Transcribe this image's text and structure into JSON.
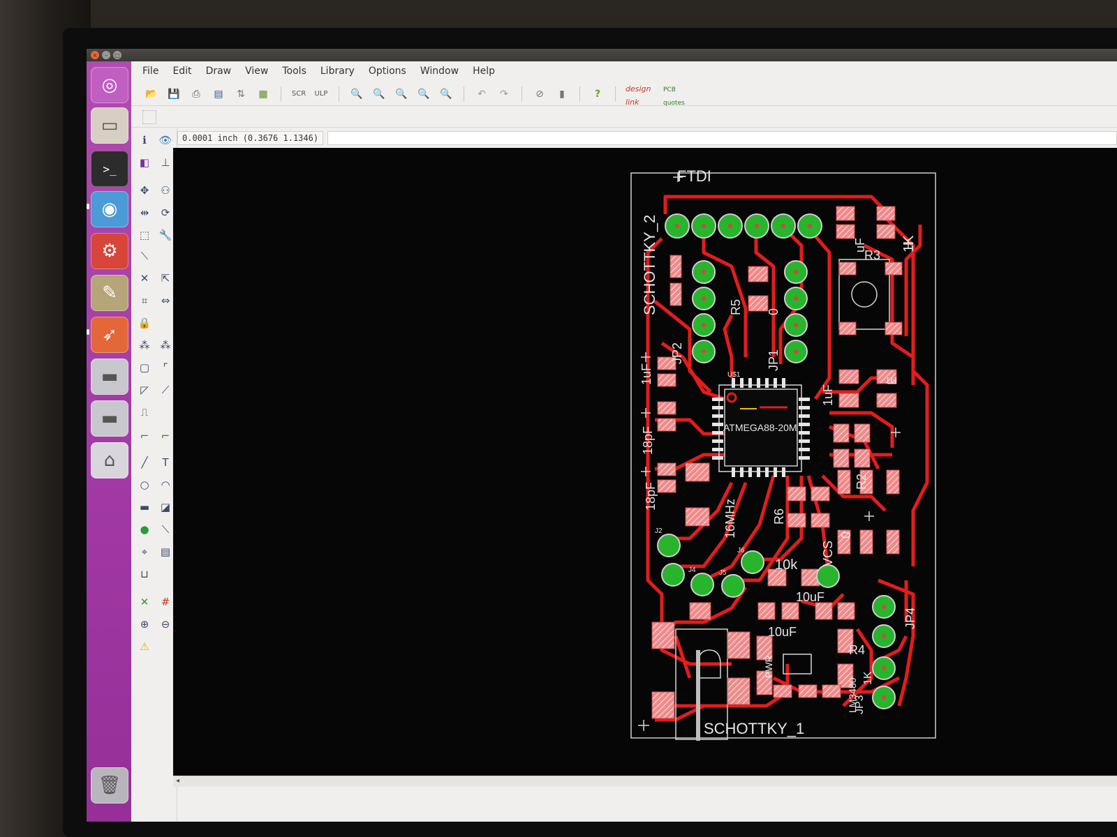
{
  "menu": [
    "File",
    "Edit",
    "Draw",
    "View",
    "Tools",
    "Library",
    "Options",
    "Window",
    "Help"
  ],
  "toolbar": {
    "icons": [
      "open-icon",
      "save-icon",
      "print-icon",
      "cam-icon",
      "board-icon",
      "script-icon",
      "ulp-icon",
      "zoom-fit-icon",
      "zoom-in-icon",
      "zoom-out-icon",
      "zoom-select-icon",
      "redraw-icon",
      "undo-icon",
      "redo-icon",
      "stop-icon",
      "go-icon",
      "help-icon"
    ],
    "brand_designlink": "design link",
    "brand_pcbquotes": "PCB quotes"
  },
  "status": {
    "coordinate": "0.0001 inch (0.3676 1.1346)",
    "command": ""
  },
  "board": {
    "labels": {
      "ftdi": "FTDI",
      "schottky2": "SCHOTTKY_2",
      "schottky1": "SCHOTTKY_1",
      "chip_name": "ATMEGA88-20M",
      "chip_ref": "U$1",
      "crystal": "16MHz",
      "r5": "R5",
      "r5_val": "0",
      "jp1": "JP1",
      "jp2": "JP2",
      "jp3": "JP3",
      "jp4": "JP4",
      "r6": "R6",
      "r2": "R2",
      "r3": "R3",
      "r4": "R4",
      "c1": "1uF",
      "c2": "18pF",
      "c3": "18pF",
      "c4": "1uF",
      "c5": "10uF",
      "c6": "10uF",
      "r10k": "10k",
      "r_1k": "1K",
      "r_1k2": "1K",
      "vcs": "VCS",
      "zero": "0",
      "uf": "uF",
      "lm": "LM3480",
      "j2": "J2",
      "j4": "J4",
      "j5": "J5",
      "j6": "J6",
      "pwr": "PWR",
      "ee": "E"
    }
  }
}
